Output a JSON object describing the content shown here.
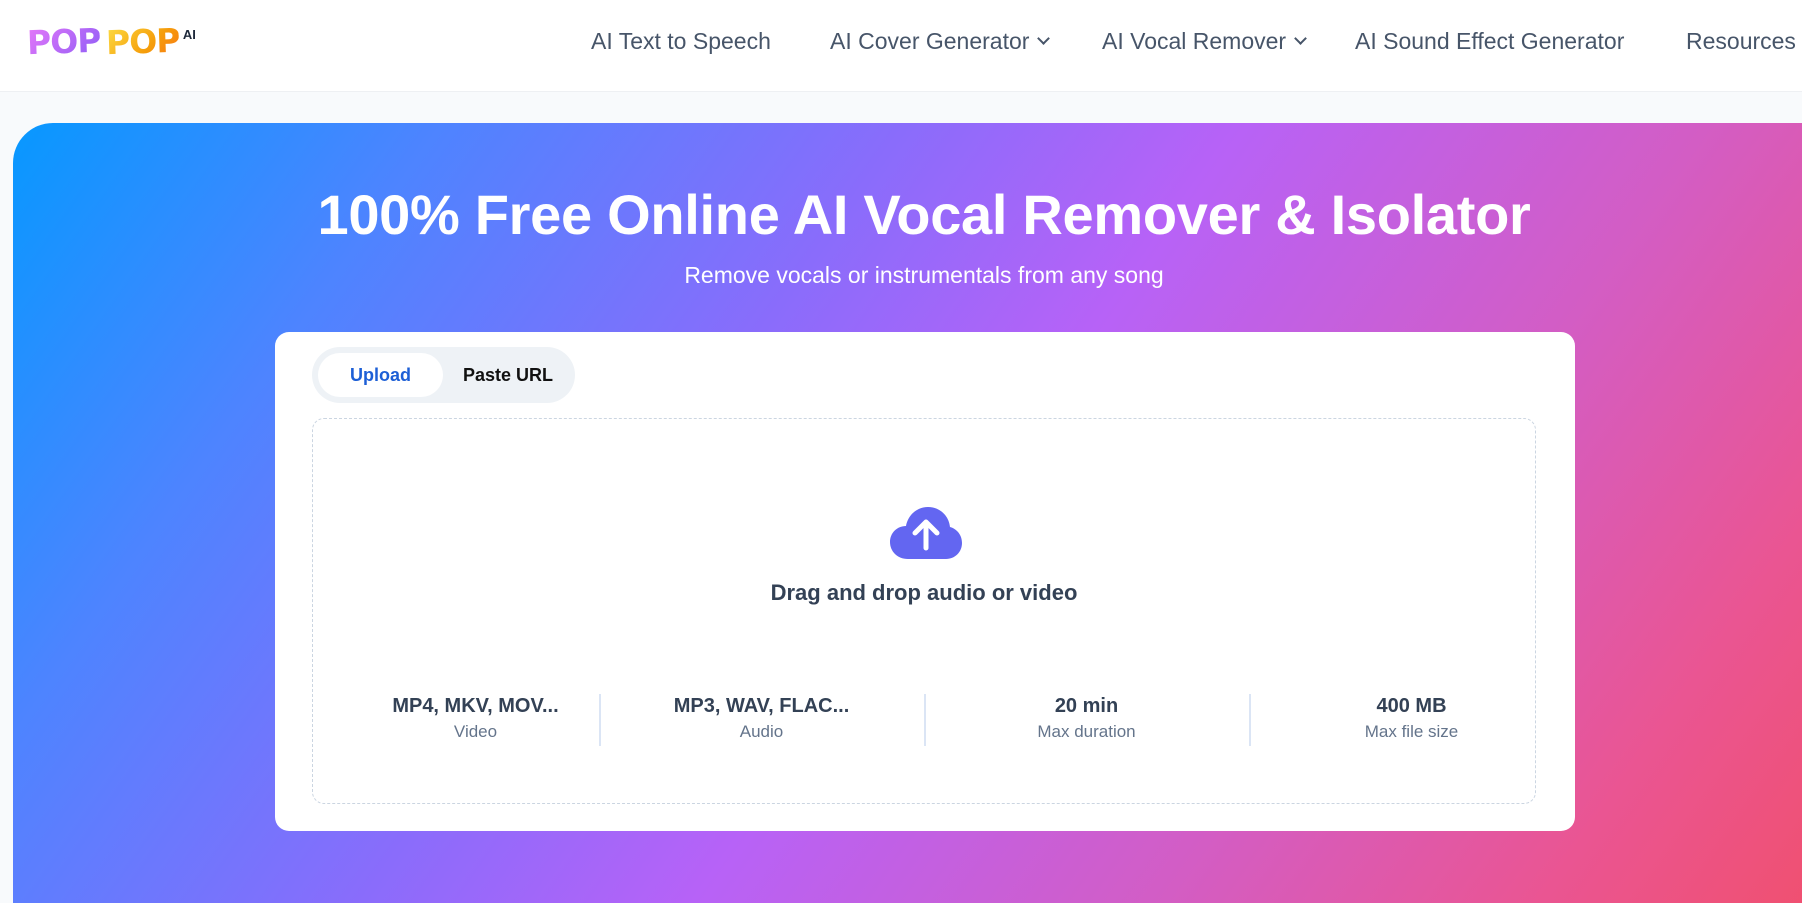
{
  "header": {
    "logo": {
      "word1": "POP",
      "word2": "POP",
      "suffix": "AI"
    },
    "nav": [
      {
        "label": "AI Text to Speech",
        "has_dropdown": false
      },
      {
        "label": "AI Cover Generator",
        "has_dropdown": true
      },
      {
        "label": "AI Vocal Remover",
        "has_dropdown": true
      },
      {
        "label": "AI Sound Effect Generator",
        "has_dropdown": false
      },
      {
        "label": "Resources",
        "has_dropdown": false
      }
    ]
  },
  "hero": {
    "title": "100% Free Online AI Vocal Remover & Isolator",
    "subtitle": "Remove vocals or instrumentals from any song",
    "gradient": [
      "#0798ff",
      "#b762f7",
      "#f0506f"
    ]
  },
  "upload_card": {
    "tabs": [
      {
        "label": "Upload",
        "active": true
      },
      {
        "label": "Paste URL",
        "active": false
      }
    ],
    "dropzone": {
      "icon": "cloud-upload-icon",
      "icon_color": "#6366f1",
      "text": "Drag and drop audio or video"
    },
    "stats": [
      {
        "value": "MP4, MKV, MOV...",
        "label": "Video"
      },
      {
        "value": "MP3, WAV, FLAC...",
        "label": "Audio"
      },
      {
        "value": "20 min",
        "label": "Max duration"
      },
      {
        "value": "400 MB",
        "label": "Max file size"
      }
    ]
  }
}
